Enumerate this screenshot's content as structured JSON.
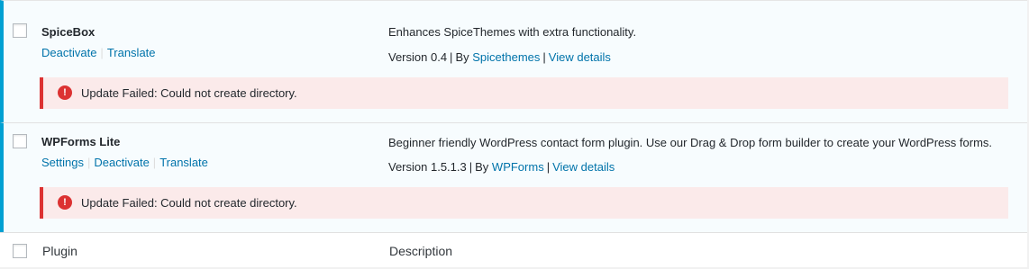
{
  "plugins": [
    {
      "name": "SpiceBox",
      "actions": [
        "Deactivate",
        "Translate"
      ],
      "description": "Enhances SpiceThemes with extra functionality.",
      "version": "Version 0.4",
      "by_prefix": "By",
      "author": "Spicethemes",
      "view_details": "View details",
      "notice": "Update Failed: Could not create directory."
    },
    {
      "name": "WPForms Lite",
      "actions": [
        "Settings",
        "Deactivate",
        "Translate"
      ],
      "description": "Beginner friendly WordPress contact form plugin. Use our Drag & Drop form builder to create your WordPress forms.",
      "version": "Version 1.5.1.3",
      "by_prefix": "By",
      "author": "WPForms",
      "view_details": "View details",
      "notice": "Update Failed: Could not create directory."
    }
  ],
  "footer": {
    "col_plugin": "Plugin",
    "col_description": "Description"
  },
  "colors": {
    "active_border": "#00a0d2",
    "error": "#dc3232",
    "link": "#0073aa"
  },
  "icons": {
    "notice": "error-icon",
    "separator": "|"
  }
}
